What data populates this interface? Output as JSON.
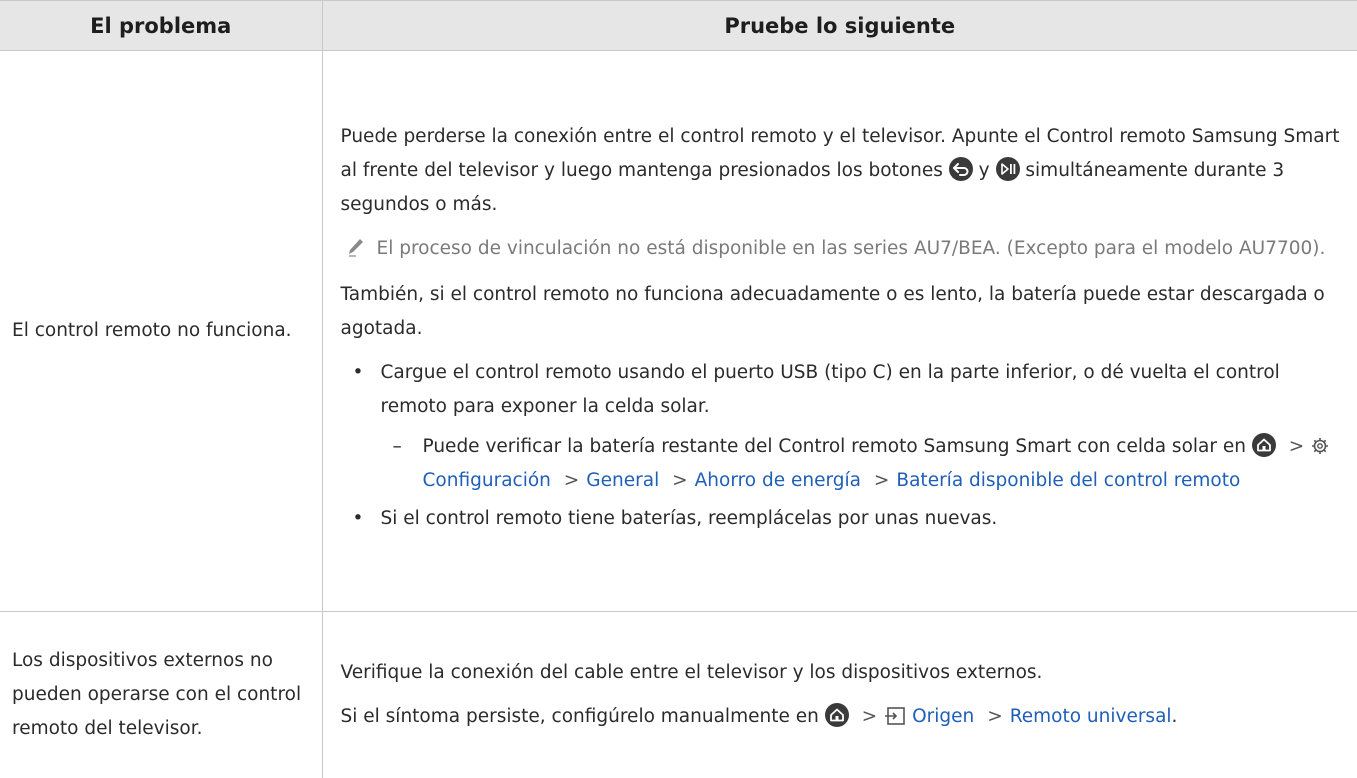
{
  "header": {
    "col_problem": "El problema",
    "col_solution": "Pruebe lo siguiente"
  },
  "rows": [
    {
      "problem": "El control remoto no funciona.",
      "p1_a": "Puede perderse la conexión entre el control remoto y el televisor. Apunte el Control remoto Samsung Smart al frente del televisor y luego mantenga presionados los botones",
      "p1_y": "y",
      "p1_b": "simultáneamente durante 3 segundos o más.",
      "note": "El proceso de vinculación no está disponible en las series AU7/BEA. (Excepto para el modelo AU7700).",
      "p2": "También, si el control remoto no funciona adecuadamente o es lento, la batería puede estar descargada o agotada.",
      "bullet1": "Cargue el control remoto usando el puerto USB (tipo C) en la parte inferior, o dé vuelta el control remoto para exponer la celda solar.",
      "dash_text": "Puede verificar la batería restante del Control remoto Samsung Smart con celda solar en",
      "path1": [
        "Configuración",
        "General",
        "Ahorro de energía",
        "Batería disponible del control remoto"
      ],
      "bullet2": "Si el control remoto tiene baterías, reemplácelas por unas nuevas."
    },
    {
      "problem": "Los dispositivos externos no pueden operarse con el control remoto del televisor.",
      "p1": "Verifique la conexión del cable entre el televisor y los dispositivos externos.",
      "p2_a": "Si el síntoma persiste, configúrelo manualmente en",
      "path2": [
        "Origen",
        "Remoto universal"
      ],
      "p2_end": "."
    }
  ],
  "icons": {
    "back": "back-button-icon",
    "play_pause": "play-pause-icon",
    "home": "home-icon",
    "settings": "gear-icon",
    "source": "source-icon",
    "note": "pencil-note-icon",
    "separator": ">"
  },
  "colors": {
    "header_bg": "#e6e6e6",
    "link_blue": "#1f5fb8",
    "note_gray": "#7a7a7a"
  }
}
